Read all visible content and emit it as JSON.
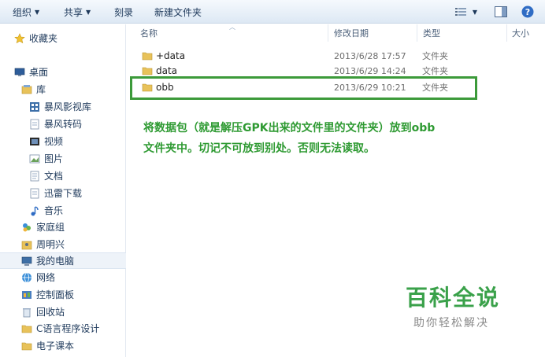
{
  "toolbar": {
    "organize": "组织",
    "share": "共享",
    "burn": "刻录",
    "new_folder": "新建文件夹"
  },
  "sidebar": {
    "items": [
      {
        "label": "收藏夹",
        "icon": "star-icon"
      },
      {
        "label": "桌面",
        "icon": "desktop-icon"
      },
      {
        "label": "库",
        "icon": "library-icon"
      },
      {
        "label": "暴风影视库",
        "icon": "video-library-icon"
      },
      {
        "label": "暴风转码",
        "icon": "document-icon"
      },
      {
        "label": "视频",
        "icon": "video-icon"
      },
      {
        "label": "图片",
        "icon": "picture-icon"
      },
      {
        "label": "文档",
        "icon": "document-icon"
      },
      {
        "label": "迅雷下载",
        "icon": "document-icon"
      },
      {
        "label": "音乐",
        "icon": "music-icon"
      },
      {
        "label": "家庭组",
        "icon": "homegroup-icon"
      },
      {
        "label": "周明兴",
        "icon": "user-folder-icon"
      },
      {
        "label": "我的电脑",
        "icon": "computer-icon"
      },
      {
        "label": "网络",
        "icon": "network-icon"
      },
      {
        "label": "控制面板",
        "icon": "control-panel-icon"
      },
      {
        "label": "回收站",
        "icon": "recycle-bin-icon"
      },
      {
        "label": "C语言程序设计",
        "icon": "folder-icon"
      },
      {
        "label": "电子课本",
        "icon": "folder-icon"
      }
    ]
  },
  "columns": {
    "name": "名称",
    "date": "修改日期",
    "type": "类型",
    "size": "大小"
  },
  "files": [
    {
      "name": "+data",
      "date": "2013/6/28 17:57",
      "type": "文件夹"
    },
    {
      "name": "data",
      "date": "2013/6/29 14:24",
      "type": "文件夹"
    },
    {
      "name": "obb",
      "date": "2013/6/29 10:21",
      "type": "文件夹"
    }
  ],
  "annotation": {
    "line1": "将数据包（就是解压GPK出来的文件里的文件夹）放到obb",
    "line2": "文件夹中。切记不可放到别处。否则无法读取。"
  },
  "watermark": {
    "title": "百科全说",
    "subtitle": "助你轻松解决"
  },
  "colors": {
    "highlight": "#3c9a3a",
    "annotation": "#2e9a32",
    "watermark": "#3aa14a",
    "folder": "#e8c25a"
  }
}
